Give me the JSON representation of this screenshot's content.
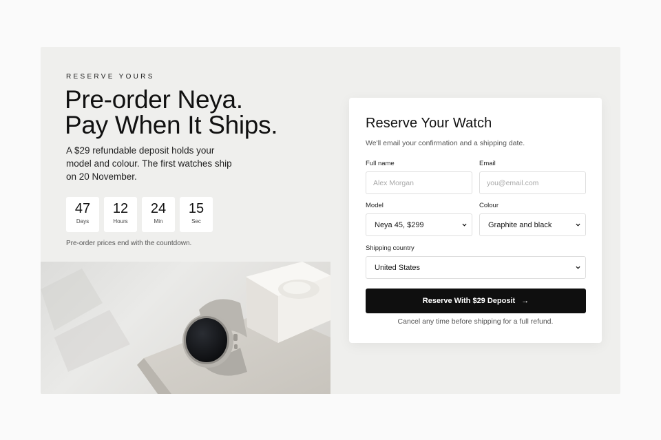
{
  "hero": {
    "eyebrow": "RESERVE YOURS",
    "headline_line1": "Pre-order Neya.",
    "headline_line2": "Pay When It Ships.",
    "subcopy": "A $29 refundable deposit holds your model and colour. The first watches ship on 20 November."
  },
  "countdown": {
    "units": [
      {
        "value": "47",
        "label": "Days"
      },
      {
        "value": "12",
        "label": "Hours"
      },
      {
        "value": "24",
        "label": "Min"
      },
      {
        "value": "15",
        "label": "Sec"
      }
    ],
    "note": "Pre-order prices end with the countdown."
  },
  "form": {
    "title": "Reserve Your Watch",
    "subtitle": "We'll email your confirmation and a shipping date.",
    "full_name_label": "Full name",
    "full_name_placeholder": "Alex Morgan",
    "email_label": "Email",
    "email_placeholder": "you@email.com",
    "model_label": "Model",
    "model_value": "Neya 45, $299",
    "colour_label": "Colour",
    "colour_value": "Graphite and black",
    "country_label": "Shipping country",
    "country_value": "United States",
    "cta_label": "Reserve With $29 Deposit",
    "cta_icon": "arrow-right-icon",
    "cancel_note": "Cancel any time before shipping for a full refund."
  },
  "colors": {
    "page_bg": "#fafafa",
    "panel_bg": "#efefed",
    "cta_bg": "#0f0f0f"
  }
}
